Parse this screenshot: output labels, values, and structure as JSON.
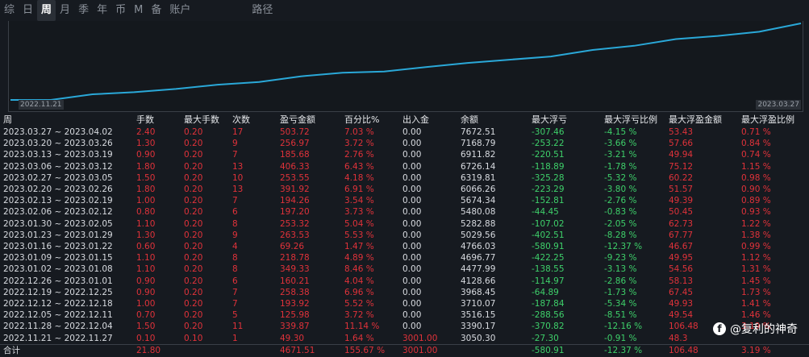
{
  "tabs": [
    "综",
    "日",
    "周",
    "月",
    "季",
    "年",
    "币",
    "M",
    "备",
    "账户",
    "路径"
  ],
  "active_tab": 2,
  "chart_data": {
    "type": "line",
    "x_start_label": "2022.11.21",
    "x_end_label": "2023.03.27",
    "series": [
      {
        "values": [
          3050.3,
          3390.17,
          3516.15,
          3710.07,
          3968.45,
          4128.66,
          4477.99,
          4696.77,
          4766.03,
          5029.56,
          5282.88,
          5480.08,
          5674.34,
          6066.26,
          6319.81,
          6726.14,
          6911.82,
          7168.79,
          7672.51
        ]
      }
    ],
    "color": "#2aa8d8"
  },
  "table": {
    "headers": [
      "周",
      "手数",
      "最大手数",
      "次数",
      "盈亏金额",
      "百分比%",
      "出入金",
      "余额",
      "最大浮亏",
      "最大浮亏比例",
      "最大浮盈金额",
      "最大浮盈比例"
    ],
    "rows": [
      [
        "2023.03.27 ~ 2023.04.02",
        "2.40",
        "0.20",
        "17",
        "503.72",
        "7.03 %",
        "0.00",
        "7672.51",
        "-307.46",
        "-4.15 %",
        "53.43",
        "0.71 %"
      ],
      [
        "2023.03.20 ~ 2023.03.26",
        "1.30",
        "0.20",
        "9",
        "256.97",
        "3.72 %",
        "0.00",
        "7168.79",
        "-253.22",
        "-3.66 %",
        "57.66",
        "0.84 %"
      ],
      [
        "2023.03.13 ~ 2023.03.19",
        "0.90",
        "0.20",
        "7",
        "185.68",
        "2.76 %",
        "0.00",
        "6911.82",
        "-220.51",
        "-3.21 %",
        "49.94",
        "0.74 %"
      ],
      [
        "2023.03.06 ~ 2023.03.12",
        "1.80",
        "0.20",
        "13",
        "406.33",
        "6.43 %",
        "0.00",
        "6726.14",
        "-118.89",
        "-1.78 %",
        "75.12",
        "1.15 %"
      ],
      [
        "2023.02.27 ~ 2023.03.05",
        "1.50",
        "0.20",
        "10",
        "253.55",
        "4.18 %",
        "0.00",
        "6319.81",
        "-325.28",
        "-5.32 %",
        "60.22",
        "0.98 %"
      ],
      [
        "2023.02.20 ~ 2023.02.26",
        "1.80",
        "0.20",
        "13",
        "391.92",
        "6.91 %",
        "0.00",
        "6066.26",
        "-223.29",
        "-3.80 %",
        "51.57",
        "0.90 %"
      ],
      [
        "2023.02.13 ~ 2023.02.19",
        "1.00",
        "0.20",
        "7",
        "194.26",
        "3.54 %",
        "0.00",
        "5674.34",
        "-152.81",
        "-2.76 %",
        "49.39",
        "0.89 %"
      ],
      [
        "2023.02.06 ~ 2023.02.12",
        "0.80",
        "0.20",
        "6",
        "197.20",
        "3.73 %",
        "0.00",
        "5480.08",
        "-44.45",
        "-0.83 %",
        "50.45",
        "0.93 %"
      ],
      [
        "2023.01.30 ~ 2023.02.05",
        "1.10",
        "0.20",
        "8",
        "253.32",
        "5.04 %",
        "0.00",
        "5282.88",
        "-107.02",
        "-2.05 %",
        "62.73",
        "1.22 %"
      ],
      [
        "2023.01.23 ~ 2023.01.29",
        "1.30",
        "0.20",
        "9",
        "263.53",
        "5.53 %",
        "0.00",
        "5029.56",
        "-402.51",
        "-8.28 %",
        "67.77",
        "1.38 %"
      ],
      [
        "2023.01.16 ~ 2023.01.22",
        "0.60",
        "0.20",
        "4",
        "69.26",
        "1.47 %",
        "0.00",
        "4766.03",
        "-580.91",
        "-12.37 %",
        "46.67",
        "0.99 %"
      ],
      [
        "2023.01.09 ~ 2023.01.15",
        "1.10",
        "0.20",
        "8",
        "218.78",
        "4.89 %",
        "0.00",
        "4696.77",
        "-422.25",
        "-9.23 %",
        "49.95",
        "1.12 %"
      ],
      [
        "2023.01.02 ~ 2023.01.08",
        "1.10",
        "0.20",
        "8",
        "349.33",
        "8.46 %",
        "0.00",
        "4477.99",
        "-138.55",
        "-3.13 %",
        "54.56",
        "1.31 %"
      ],
      [
        "2022.12.26 ~ 2023.01.01",
        "0.90",
        "0.20",
        "6",
        "160.21",
        "4.04 %",
        "0.00",
        "4128.66",
        "-114.97",
        "-2.86 %",
        "58.13",
        "1.45 %"
      ],
      [
        "2022.12.19 ~ 2022.12.25",
        "0.90",
        "0.20",
        "7",
        "258.38",
        "6.96 %",
        "0.00",
        "3968.45",
        "-64.89",
        "-1.73 %",
        "67.45",
        "1.73 %"
      ],
      [
        "2022.12.12 ~ 2022.12.18",
        "1.00",
        "0.20",
        "7",
        "193.92",
        "5.52 %",
        "0.00",
        "3710.07",
        "-187.84",
        "-5.34 %",
        "49.93",
        "1.41 %"
      ],
      [
        "2022.12.05 ~ 2022.12.11",
        "0.70",
        "0.20",
        "5",
        "125.98",
        "3.72 %",
        "0.00",
        "3516.15",
        "-288.56",
        "-8.51 %",
        "49.54",
        "1.46 %"
      ],
      [
        "2022.11.28 ~ 2022.12.04",
        "1.50",
        "0.20",
        "11",
        "339.87",
        "11.14 %",
        "0.00",
        "3390.17",
        "-370.82",
        "-12.16 %",
        "106.48",
        "3.19 %"
      ],
      [
        "2022.11.21 ~ 2022.11.27",
        "0.10",
        "0.10",
        "1",
        "49.30",
        "1.64 %",
        "3001.00",
        "3050.30",
        "-27.30",
        "-0.91 %",
        "48.3",
        ""
      ]
    ],
    "total": [
      "合计",
      "21.80",
      "",
      "",
      "4671.51",
      "155.67 %",
      "3001.00",
      "",
      "-580.91",
      "-12.37 %",
      "106.48",
      "3.19 %"
    ]
  },
  "watermark": {
    "text": "@复利的神奇",
    "icon": "f"
  },
  "colors": {
    "up": "#e0323a",
    "down": "#3ed06a",
    "line": "#2aa8d8",
    "bg": "#161a20"
  }
}
